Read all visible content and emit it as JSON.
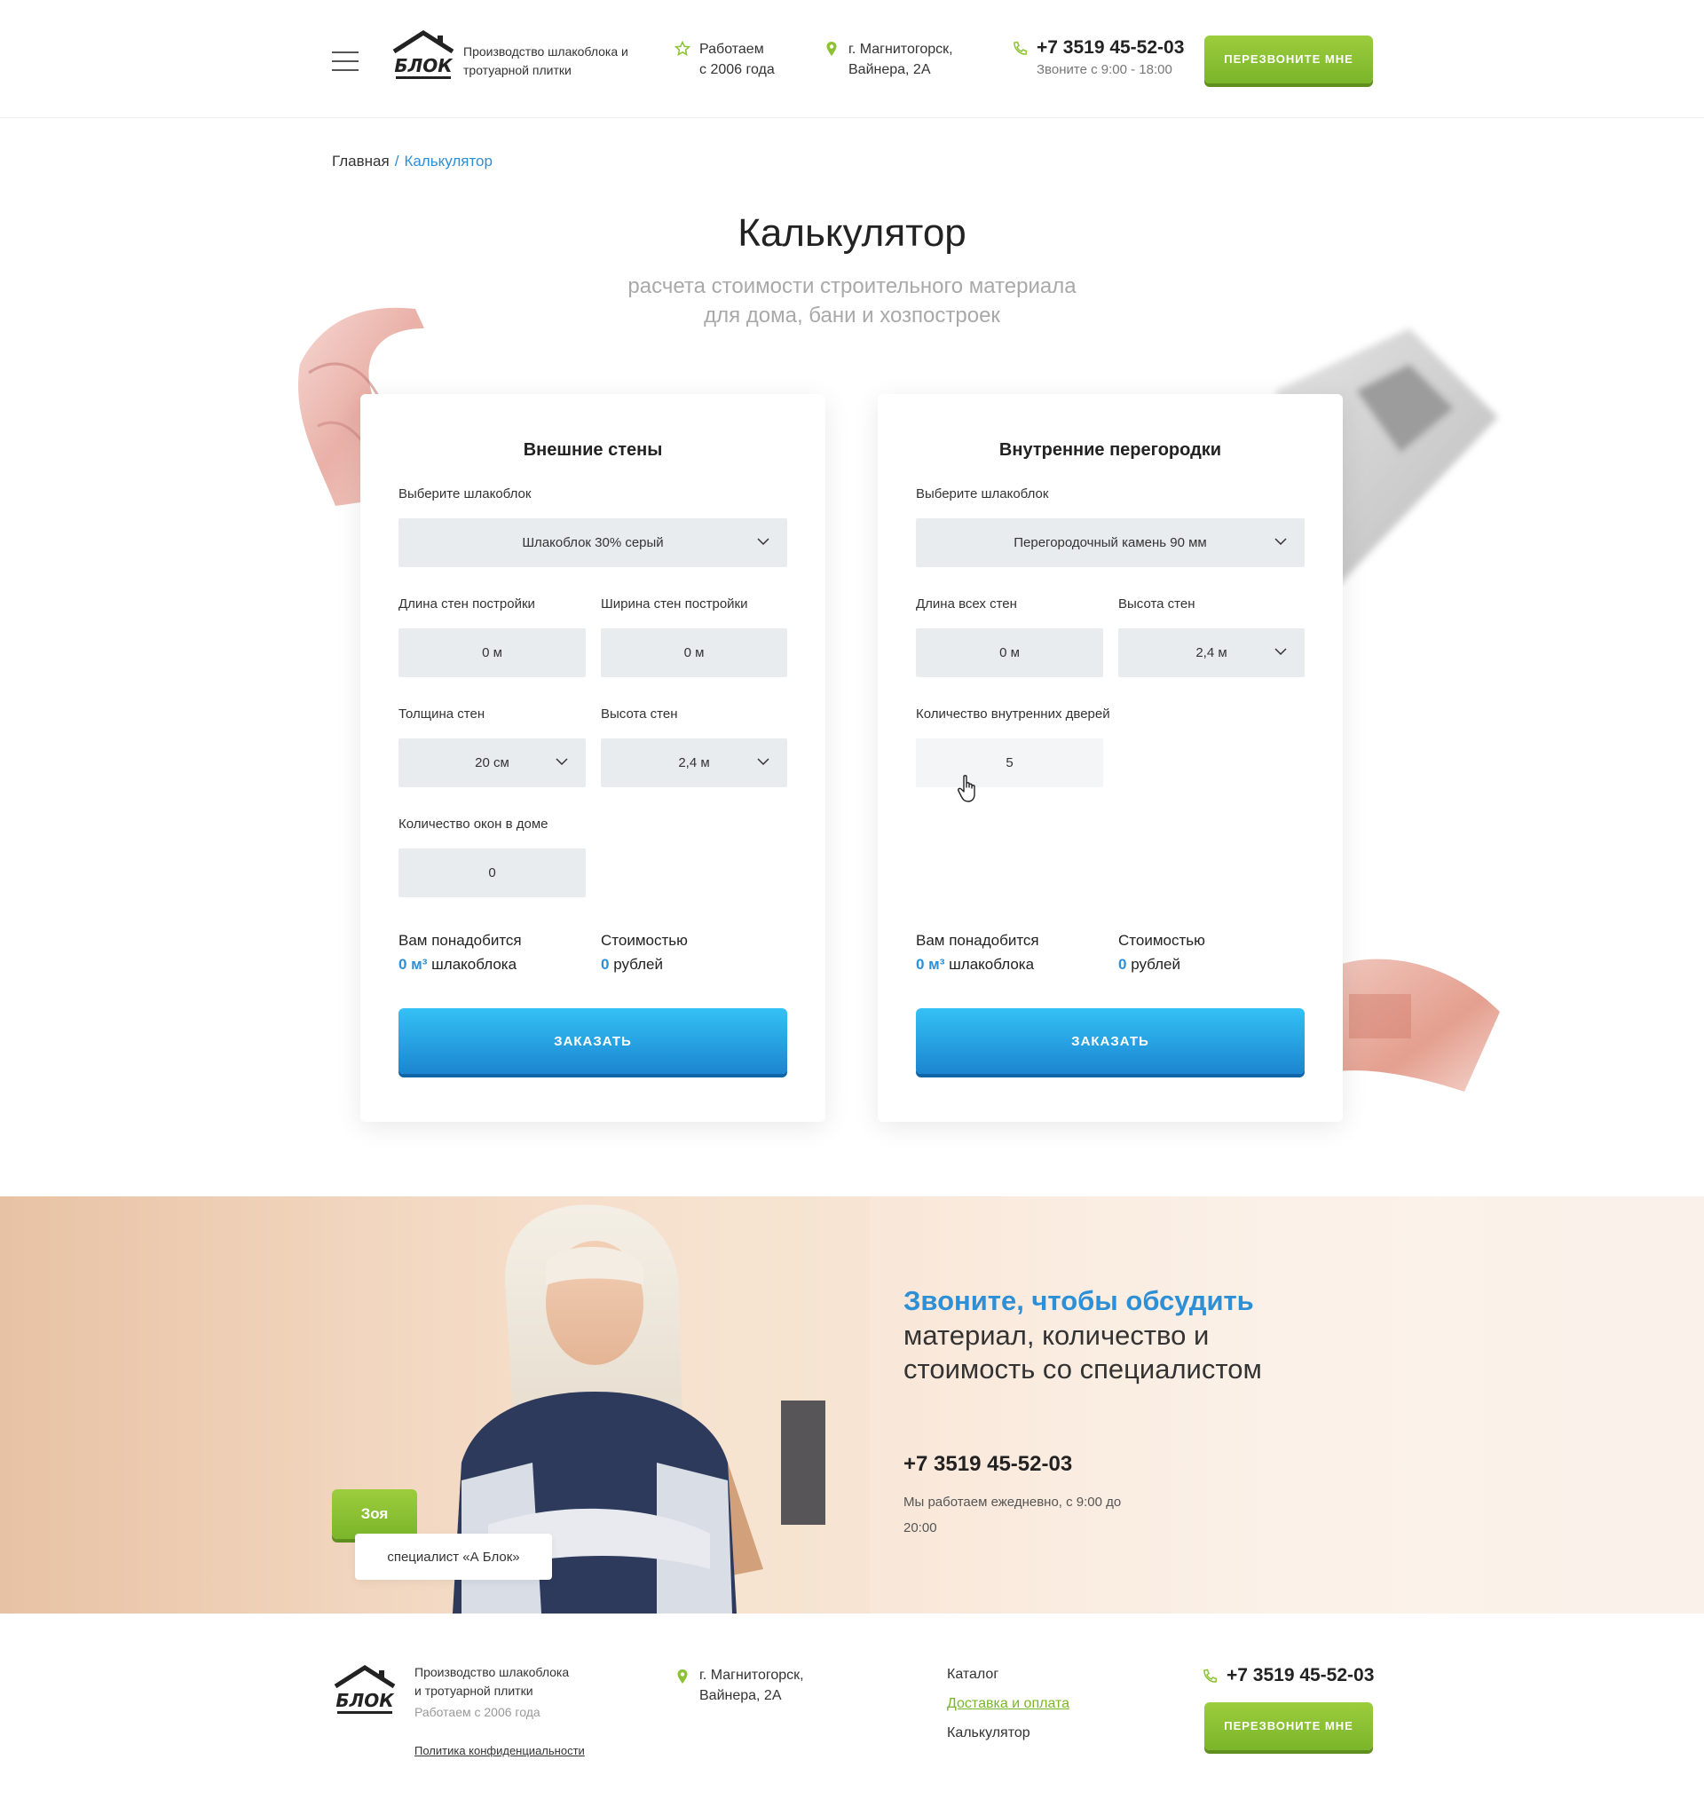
{
  "header": {
    "logo_word": "БЛОК",
    "tagline": "Производство шлакоблока и тротуарной плитки",
    "since_line1": "Работаем",
    "since_line2": "с 2006 года",
    "address_line1": "г. Магнитогорск,",
    "address_line2": "Вайнера, 2А",
    "phone": "+7 3519 45-52-03",
    "phone_hours": "Звоните с 9:00 - 18:00",
    "callback_label": "ПЕРЕЗВОНИТЕ МНЕ"
  },
  "breadcrumb": {
    "home": "Главная",
    "separator": "/",
    "current": "Калькулятор"
  },
  "page": {
    "title": "Калькулятор",
    "subtitle_line1": "расчета стоимости строительного материала",
    "subtitle_line2": "для дома, бани и хозпостроек"
  },
  "outer": {
    "title": "Внешние стены",
    "block_label": "Выберите шлакоблок",
    "block_value": "Шлакоблок 30% серый",
    "length_label": "Длина стен постройки",
    "length_value": "0 м",
    "width_label": "Ширина стен постройки",
    "width_value": "0 м",
    "thickness_label": "Толщина стен",
    "thickness_value": "20 см",
    "height_label": "Высота стен",
    "height_value": "2,4 м",
    "windows_label": "Количество окон в доме",
    "windows_value": "0",
    "need_label": "Вам понадобится",
    "need_value": "0 м³",
    "need_unit": "шлакоблока",
    "cost_label": "Стоимостью",
    "cost_value": "0",
    "cost_unit": "рублей",
    "order_label": "ЗАКАЗАТЬ"
  },
  "inner": {
    "title": "Внутренние перегородки",
    "block_label": "Выберите шлакоблок",
    "block_value": "Перегородочный камень 90 мм",
    "length_label": "Длина всех стен",
    "length_value": "0 м",
    "height_label": "Высота стен",
    "height_value": "2,4 м",
    "doors_label": "Количество внутренних дверей",
    "doors_value": "5",
    "need_label": "Вам понадобится",
    "need_value": "0 м³",
    "need_unit": "шлакоблока",
    "cost_label": "Стоимостью",
    "cost_value": "0",
    "cost_unit": "рублей",
    "order_label": "ЗАКАЗАТЬ"
  },
  "banner": {
    "heading_accent": "Звоните, чтобы обсудить",
    "heading_rest": "материал, количество и стоимость со специалистом",
    "phone": "+7 3519 45-52-03",
    "note": "Мы работаем ежедневно, с 9:00 до 20:00",
    "person_name": "Зоя",
    "person_role": "специалист «А Блок»"
  },
  "footer": {
    "logo_word": "БЛОК",
    "tagline_line1": "Производство шлакоблока",
    "tagline_line2": "и тротуарной плитки",
    "since": "Работаем с 2006 года",
    "privacy": "Политика конфиденциальности",
    "address_line1": "г. Магнитогорск,",
    "address_line2": "Вайнера, 2А",
    "nav": [
      "Каталог",
      "Доставка и оплата",
      "Калькулятор"
    ],
    "phone": "+7 3519 45-52-03",
    "callback_label": "ПЕРЕЗВОНИТЕ МНЕ"
  },
  "colors": {
    "accent_blue": "#2d8fd6",
    "accent_green": "#8cc234",
    "field_bg": "#e9ecef"
  },
  "icons": [
    "menu-icon",
    "star-icon",
    "map-pin-icon",
    "phone-icon",
    "chevron-down-icon",
    "hand-cursor-icon"
  ]
}
